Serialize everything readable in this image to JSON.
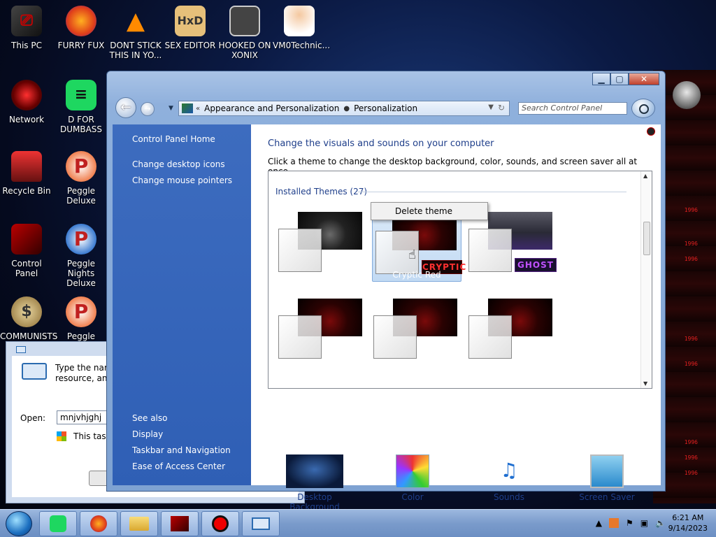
{
  "desktop": {
    "icons": [
      {
        "label": "This PC"
      },
      {
        "label": "FURRY FUX"
      },
      {
        "label": "DONT STICK THIS IN YO..."
      },
      {
        "label": "SEX EDITOR"
      },
      {
        "label": "HOOKED ON XONIX"
      },
      {
        "label": "VM0Technic..."
      },
      {
        "label": "Network"
      },
      {
        "label": "D FOR DUMBASS"
      },
      {
        "label": "Recycle Bin"
      },
      {
        "label": "Peggle Deluxe"
      },
      {
        "label": "Control Panel"
      },
      {
        "label": "Peggle Nights Deluxe"
      },
      {
        "label": "COMMUNISTS"
      },
      {
        "label": "Peggle World"
      }
    ],
    "deco_text": [
      "1996",
      "1996",
      "1996",
      "1996",
      "1996",
      "1996",
      "1996",
      "1996"
    ]
  },
  "run_dialog": {
    "description": "Type the nam resource, and",
    "open_label": "Open:",
    "open_value": "mnjvhjghj",
    "task_text": "This task"
  },
  "window": {
    "buttons": {
      "minimize": "▁",
      "maximize": "▢",
      "close": "✕"
    },
    "address": {
      "segment_1": "Appearance and Personalization",
      "segment_2": "Personalization"
    },
    "search_placeholder": "Search Control Panel",
    "sidebar": {
      "home": "Control Panel Home",
      "links": [
        "Change desktop icons",
        "Change mouse pointers"
      ],
      "see_also": "See also",
      "see_also_links": [
        "Display",
        "Taskbar and Navigation",
        "Ease of Access Center"
      ]
    },
    "content": {
      "heading": "Change the visuals and sounds on your computer",
      "subheading": "Click a theme to change the desktop background, color, sounds, and screen saver all at once.",
      "group_title": "Installed Themes (27)",
      "themes": [
        {
          "name": "",
          "badge": ""
        },
        {
          "name": "Cryptic Red",
          "badge": "CRYPTIC"
        },
        {
          "name": "",
          "badge": "GHOST"
        },
        {
          "name": "",
          "badge": ""
        },
        {
          "name": "",
          "badge": ""
        },
        {
          "name": "",
          "badge": ""
        }
      ],
      "bottom_items": [
        {
          "label": "Desktop Background"
        },
        {
          "label": "Color"
        },
        {
          "label": "Sounds"
        },
        {
          "label": "Screen Saver"
        }
      ]
    },
    "context_menu": {
      "item": "Delete theme"
    }
  },
  "taskbar": {
    "clock_time": "6:21 AM",
    "clock_date": "9/14/2023"
  }
}
